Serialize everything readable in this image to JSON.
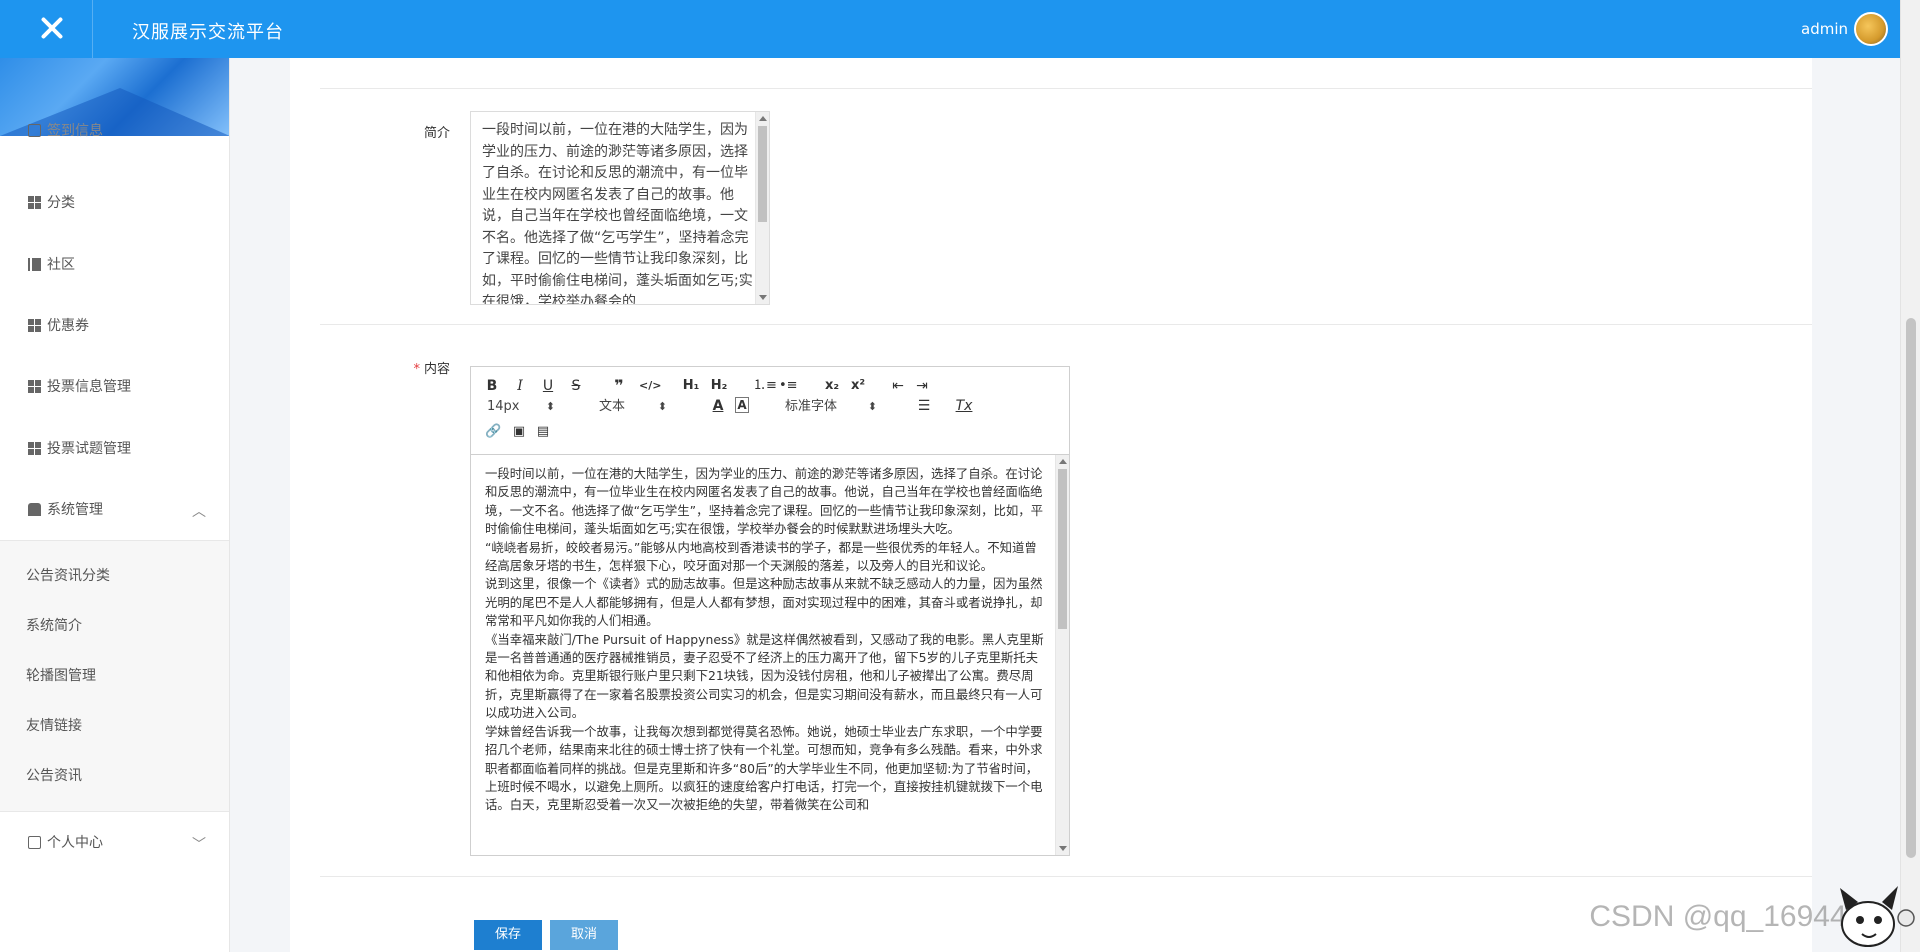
{
  "app": {
    "title": "汉服展示交流平台",
    "user": "admin",
    "brand_color": "#1e95ef"
  },
  "sidebar": {
    "top_partial": "签到信息",
    "items": [
      {
        "label": "分类",
        "icon": "grid-icon"
      },
      {
        "label": "社区",
        "icon": "book-icon"
      },
      {
        "label": "优惠券",
        "icon": "grid-icon"
      },
      {
        "label": "投票信息管理",
        "icon": "grid-icon"
      },
      {
        "label": "投票试题管理",
        "icon": "grid-icon"
      },
      {
        "label": "系统管理",
        "icon": "system-icon",
        "expanded": true
      }
    ],
    "sub_items": [
      "公告资讯分类",
      "系统简介",
      "轮播图管理",
      "友情链接",
      "公告资讯"
    ],
    "personal": {
      "label": "个人中心",
      "icon": "id-card-icon"
    }
  },
  "form": {
    "intro_label": "简介",
    "intro_value": "一段时间以前，一位在港的大陆学生，因为学业的压力、前途的渺茫等诸多原因，选择了自杀。在讨论和反思的潮流中，有一位毕业生在校内网匿名发表了自己的故事。他说，自己当年在学校也曾经面临绝境，一文不名。他选择了做“乞丐学生”，坚持着念完了课程。回忆的一些情节让我印象深刻，比如，平时偷偷住电梯间，蓬头垢面如乞丐;实在很饿，学校举办餐会的",
    "content_label": "内容",
    "content_required": "*",
    "toolbar": {
      "font_size": "14px",
      "block_type": "文本",
      "font_family": "标准字体"
    },
    "content_paragraphs": [
      "一段时间以前，一位在港的大陆学生，因为学业的压力、前途的渺茫等诸多原因，选择了自杀。在讨论和反思的潮流中，有一位毕业生在校内网匿名发表了自己的故事。他说，自己当年在学校也曾经面临绝境，一文不名。他选择了做“乞丐学生”，坚持着念完了课程。回忆的一些情节让我印象深刻，比如，平时偷偷住电梯间，蓬头垢面如乞丐;实在很饿，学校举办餐会的时候默默进场埋头大吃。",
      "“峣峣者易折，皎皎者易污。”能够从内地高校到香港读书的学子，都是一些很优秀的年轻人。不知道曾经高居象牙塔的书生，怎样狠下心，咬牙面对那一个天渊般的落差，以及旁人的目光和议论。",
      "说到这里，很像一个《读者》式的励志故事。但是这种励志故事从来就不缺乏感动人的力量，因为虽然光明的尾巴不是人人都能够拥有，但是人人都有梦想，面对实现过程中的困难，其奋斗或者说挣扎，却常常和平凡如你我的人们相通。",
      "《当幸福来敲门/The Pursuit of Happyness》就是这样偶然被看到，又感动了我的电影。黑人克里斯是一名普普通通的医疗器械推销员，妻子忍受不了经济上的压力离开了他，留下5岁的儿子克里斯托夫和他相依为命。克里斯银行账户里只剩下21块钱，因为没钱付房租，他和儿子被撵出了公寓。费尽周折，克里斯赢得了在一家着名股票投资公司实习的机会，但是实习期间没有薪水，而且最终只有一人可以成功进入公司。",
      "学妹曾经告诉我一个故事，让我每次想到都觉得莫名恐怖。她说，她硕士毕业去广东求职，一个中学要招几个老师，结果南来北往的硕士博士挤了快有一个礼堂。可想而知，竞争有多么残酷。看来，中外求职者都面临着同样的挑战。但是克里斯和许多“80后”的大学毕业生不同，他更加坚韧:为了节省时间，上班时候不喝水，以避免上厕所。以疯狂的速度给客户打电话，打完一个，直接按挂机键就拨下一个电话。白天，克里斯忍受着一次又一次被拒绝的失望，带着微笑在公司和"
    ]
  },
  "buttons": {
    "save": "保存",
    "cancel": "取消"
  },
  "watermark": "CSDN @qq_1694456"
}
